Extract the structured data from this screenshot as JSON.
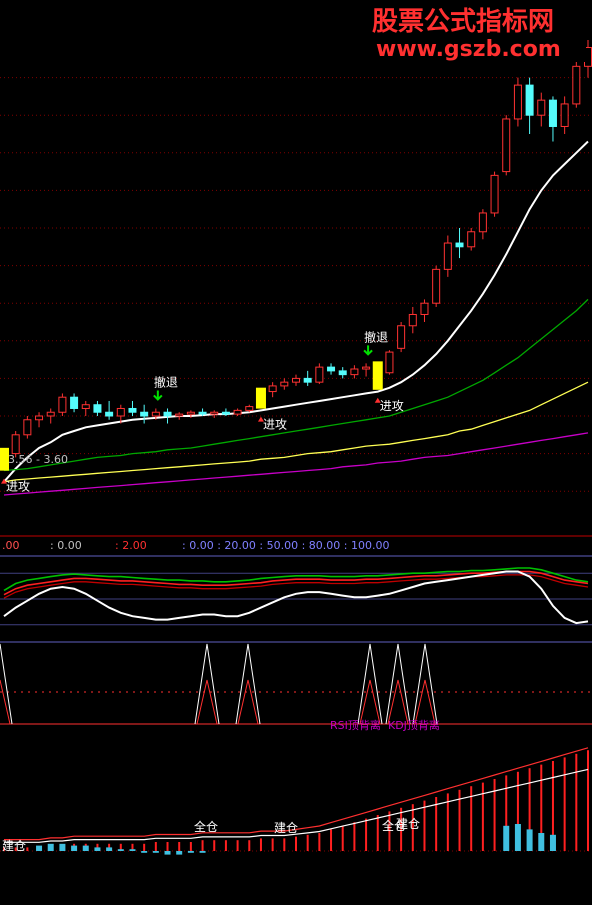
{
  "watermark": {
    "line1": "股票公式指标网",
    "line2": "www.gszb.com"
  },
  "main_panel": {
    "price_range_label": "3.56 - 3.60",
    "signals": [
      {
        "text": "撤退",
        "type": "retreat"
      },
      {
        "text": "进攻",
        "type": "attack"
      },
      {
        "text": "撤退",
        "type": "retreat"
      },
      {
        "text": "进攻",
        "type": "attack"
      },
      {
        "text": "进攻",
        "type": "attack"
      }
    ]
  },
  "indicator_header": {
    "items": [
      ".00",
      ": 0.00",
      ": 2.00",
      ": 0.00 : 20.00 : 50.00 : 80.00 : 100.00"
    ]
  },
  "divergence_labels": {
    "rsi": "RSI顶背离",
    "kdj": "KDJ顶背离"
  },
  "position_labels": [
    "建仓",
    "全仓",
    "建仓",
    "全仓",
    "建仓"
  ],
  "colors": {
    "up_candle": "#ff3232",
    "down_candle": "#54fcfc",
    "ma_white": "#ffffff",
    "ma_yellow": "#ffff54",
    "ma_green": "#00a800",
    "ma_magenta": "#c800c8",
    "grid": "#800000",
    "signal_yellow": "#ffff00"
  },
  "chart_data": [
    {
      "type": "candlestick",
      "candles": [
        [
          3.45,
          3.52,
          3.42,
          3.5
        ],
        [
          3.5,
          3.62,
          3.48,
          3.6
        ],
        [
          3.6,
          3.7,
          3.58,
          3.68
        ],
        [
          3.68,
          3.72,
          3.64,
          3.7
        ],
        [
          3.7,
          3.74,
          3.66,
          3.72
        ],
        [
          3.72,
          3.82,
          3.7,
          3.8
        ],
        [
          3.8,
          3.82,
          3.72,
          3.74
        ],
        [
          3.74,
          3.78,
          3.7,
          3.76
        ],
        [
          3.76,
          3.78,
          3.7,
          3.72
        ],
        [
          3.72,
          3.78,
          3.68,
          3.7
        ],
        [
          3.7,
          3.76,
          3.66,
          3.74
        ],
        [
          3.74,
          3.78,
          3.7,
          3.72
        ],
        [
          3.72,
          3.76,
          3.66,
          3.7
        ],
        [
          3.7,
          3.74,
          3.68,
          3.72
        ],
        [
          3.72,
          3.74,
          3.66,
          3.7
        ],
        [
          3.7,
          3.72,
          3.68,
          3.71
        ],
        [
          3.71,
          3.73,
          3.69,
          3.72
        ],
        [
          3.72,
          3.74,
          3.7,
          3.71
        ],
        [
          3.71,
          3.73,
          3.69,
          3.72
        ],
        [
          3.72,
          3.74,
          3.7,
          3.71
        ],
        [
          3.71,
          3.74,
          3.7,
          3.73
        ],
        [
          3.73,
          3.76,
          3.72,
          3.75
        ],
        [
          3.76,
          3.84,
          3.75,
          3.83
        ],
        [
          3.83,
          3.88,
          3.8,
          3.86
        ],
        [
          3.86,
          3.9,
          3.84,
          3.88
        ],
        [
          3.88,
          3.92,
          3.86,
          3.9
        ],
        [
          3.9,
          3.94,
          3.86,
          3.88
        ],
        [
          3.88,
          3.98,
          3.87,
          3.96
        ],
        [
          3.96,
          3.98,
          3.92,
          3.94
        ],
        [
          3.94,
          3.96,
          3.9,
          3.92
        ],
        [
          3.92,
          3.97,
          3.9,
          3.95
        ],
        [
          3.95,
          3.98,
          3.91,
          3.96
        ],
        [
          3.96,
          3.98,
          3.85,
          3.93
        ],
        [
          3.93,
          4.05,
          3.92,
          4.04
        ],
        [
          4.06,
          4.2,
          4.04,
          4.18
        ],
        [
          4.18,
          4.28,
          4.14,
          4.24
        ],
        [
          4.24,
          4.32,
          4.2,
          4.3
        ],
        [
          4.3,
          4.5,
          4.28,
          4.48
        ],
        [
          4.48,
          4.66,
          4.44,
          4.62
        ],
        [
          4.62,
          4.7,
          4.54,
          4.6
        ],
        [
          4.6,
          4.7,
          4.58,
          4.68
        ],
        [
          4.68,
          4.8,
          4.64,
          4.78
        ],
        [
          4.78,
          5.0,
          4.76,
          4.98
        ],
        [
          5.0,
          5.3,
          4.98,
          5.28
        ],
        [
          5.28,
          5.5,
          5.24,
          5.46
        ],
        [
          5.46,
          5.5,
          5.2,
          5.3
        ],
        [
          5.3,
          5.42,
          5.24,
          5.38
        ],
        [
          5.38,
          5.4,
          5.16,
          5.24
        ],
        [
          5.24,
          5.4,
          5.2,
          5.36
        ],
        [
          5.36,
          5.6,
          5.34,
          5.56
        ],
        [
          5.56,
          5.7,
          5.5,
          5.66
        ]
      ],
      "moving_averages": [
        {
          "name": "white",
          "values": [
            3.35,
            3.42,
            3.48,
            3.53,
            3.56,
            3.6,
            3.62,
            3.64,
            3.65,
            3.66,
            3.67,
            3.68,
            3.685,
            3.69,
            3.695,
            3.7,
            3.7,
            3.705,
            3.71,
            3.71,
            3.715,
            3.72,
            3.73,
            3.74,
            3.75,
            3.76,
            3.77,
            3.78,
            3.79,
            3.8,
            3.81,
            3.82,
            3.83,
            3.85,
            3.88,
            3.92,
            3.97,
            4.03,
            4.1,
            4.18,
            4.26,
            4.35,
            4.45,
            4.56,
            4.68,
            4.8,
            4.9,
            4.98,
            5.04,
            5.1,
            5.16
          ]
        },
        {
          "name": "green",
          "values": [
            3.41,
            3.415,
            3.42,
            3.43,
            3.44,
            3.45,
            3.46,
            3.47,
            3.48,
            3.485,
            3.49,
            3.5,
            3.505,
            3.51,
            3.52,
            3.525,
            3.53,
            3.54,
            3.55,
            3.56,
            3.57,
            3.58,
            3.59,
            3.6,
            3.61,
            3.62,
            3.63,
            3.64,
            3.65,
            3.66,
            3.67,
            3.68,
            3.69,
            3.7,
            3.72,
            3.74,
            3.76,
            3.78,
            3.8,
            3.83,
            3.86,
            3.89,
            3.93,
            3.97,
            4.01,
            4.06,
            4.11,
            4.16,
            4.21,
            4.26,
            4.32
          ]
        },
        {
          "name": "yellow",
          "values": [
            3.35,
            3.36,
            3.365,
            3.37,
            3.375,
            3.38,
            3.385,
            3.39,
            3.395,
            3.4,
            3.405,
            3.41,
            3.415,
            3.42,
            3.425,
            3.43,
            3.435,
            3.44,
            3.445,
            3.45,
            3.455,
            3.46,
            3.47,
            3.475,
            3.48,
            3.49,
            3.5,
            3.505,
            3.51,
            3.52,
            3.53,
            3.54,
            3.545,
            3.55,
            3.56,
            3.57,
            3.58,
            3.59,
            3.6,
            3.62,
            3.63,
            3.65,
            3.67,
            3.69,
            3.71,
            3.73,
            3.76,
            3.79,
            3.82,
            3.85,
            3.88
          ]
        },
        {
          "name": "magenta",
          "values": [
            3.28,
            3.285,
            3.29,
            3.295,
            3.3,
            3.305,
            3.31,
            3.315,
            3.32,
            3.325,
            3.33,
            3.335,
            3.34,
            3.345,
            3.35,
            3.355,
            3.36,
            3.365,
            3.37,
            3.375,
            3.38,
            3.385,
            3.39,
            3.395,
            3.4,
            3.405,
            3.41,
            3.415,
            3.42,
            3.43,
            3.435,
            3.44,
            3.45,
            3.455,
            3.46,
            3.47,
            3.48,
            3.485,
            3.49,
            3.5,
            3.51,
            3.52,
            3.53,
            3.54,
            3.55,
            3.56,
            3.57,
            3.58,
            3.59,
            3.6,
            3.61
          ]
        }
      ]
    },
    {
      "type": "line",
      "ylim": [
        0,
        100
      ],
      "reference_lines": [
        0,
        20,
        50,
        80,
        100
      ],
      "series": [
        {
          "values": [
            60,
            68,
            72,
            74,
            76,
            78,
            79,
            78,
            77,
            76,
            76,
            75,
            74,
            73,
            72,
            72,
            71,
            71,
            70,
            70,
            71,
            72,
            74,
            75,
            76,
            77,
            77,
            77,
            76,
            76,
            76,
            77,
            77,
            78,
            79,
            80,
            80,
            81,
            82,
            82,
            83,
            83,
            84,
            85,
            86,
            86,
            84,
            80,
            76,
            72,
            70
          ]
        },
        {
          "values": [
            55,
            62,
            66,
            68,
            70,
            72,
            74,
            74,
            73,
            72,
            71,
            71,
            70,
            69,
            68,
            67,
            67,
            66,
            66,
            66,
            67,
            68,
            69,
            71,
            72,
            73,
            73,
            73,
            72,
            72,
            72,
            73,
            73,
            74,
            75,
            76,
            77,
            77,
            78,
            79,
            80,
            80,
            81,
            82,
            82,
            82,
            80,
            76,
            72,
            70,
            68
          ]
        },
        {
          "values": [
            30,
            40,
            48,
            56,
            62,
            64,
            62,
            56,
            48,
            40,
            34,
            30,
            28,
            26,
            26,
            28,
            30,
            32,
            32,
            30,
            30,
            34,
            40,
            46,
            52,
            56,
            58,
            58,
            56,
            54,
            52,
            52,
            54,
            56,
            60,
            64,
            68,
            70,
            72,
            74,
            76,
            78,
            80,
            82,
            82,
            76,
            62,
            42,
            28,
            22,
            24
          ]
        }
      ]
    },
    {
      "type": "bar",
      "series": [
        {
          "name": "red",
          "values": [
            2,
            2,
            2,
            2,
            3,
            3,
            4,
            4,
            4,
            4,
            4,
            4,
            4,
            5,
            5,
            5,
            5,
            6,
            6,
            6,
            6,
            6,
            7,
            7,
            7,
            8,
            9,
            10,
            12,
            14,
            16,
            18,
            20,
            22,
            24,
            26,
            28,
            30,
            32,
            34,
            36,
            38,
            40,
            42,
            44,
            46,
            48,
            50,
            52,
            54,
            56
          ]
        },
        {
          "name": "cyan",
          "values": [
            0,
            0,
            0,
            3,
            4,
            4,
            3,
            3,
            2,
            2,
            1,
            1,
            -1,
            -1,
            -2,
            -2,
            -1,
            -1,
            0,
            0,
            0,
            0,
            0,
            0,
            0,
            0,
            0,
            0,
            0,
            0,
            0,
            0,
            0,
            0,
            0,
            0,
            0,
            0,
            0,
            0,
            0,
            0,
            0,
            14,
            15,
            12,
            10,
            9,
            0,
            0,
            0
          ]
        }
      ]
    }
  ]
}
